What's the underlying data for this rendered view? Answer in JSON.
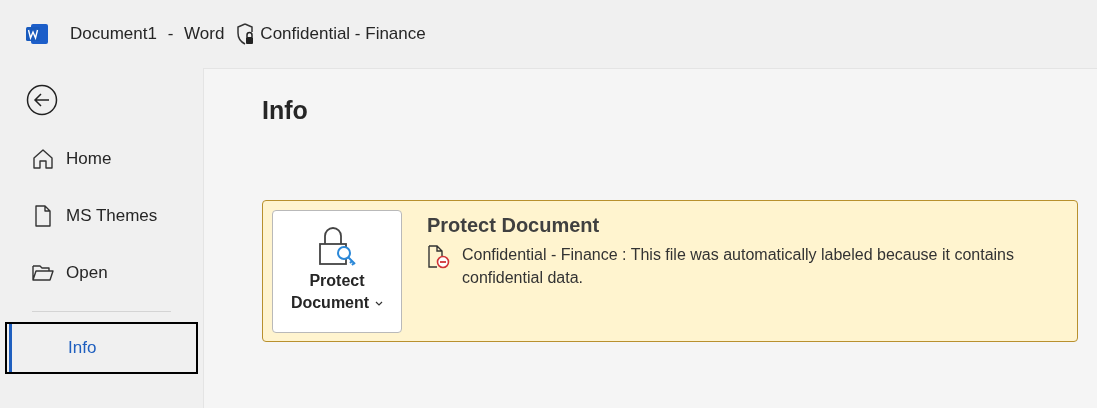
{
  "window": {
    "title": "Document1 - Word",
    "sensitivity_label": "Confidential - Finance"
  },
  "sidebar": {
    "items": [
      {
        "label": "Home",
        "kind": "home",
        "selected": false
      },
      {
        "label": "MS Themes",
        "kind": "file",
        "selected": false
      },
      {
        "label": "Open",
        "kind": "folder",
        "selected": false
      },
      {
        "label": "Info",
        "kind": "none",
        "selected": true
      }
    ]
  },
  "page": {
    "heading": "Info",
    "protect": {
      "button_line1": "Protect",
      "button_line2": "Document",
      "title": "Protect Document",
      "message": "Confidential - Finance : This file was automatically labeled because it contains confidential data."
    }
  }
}
